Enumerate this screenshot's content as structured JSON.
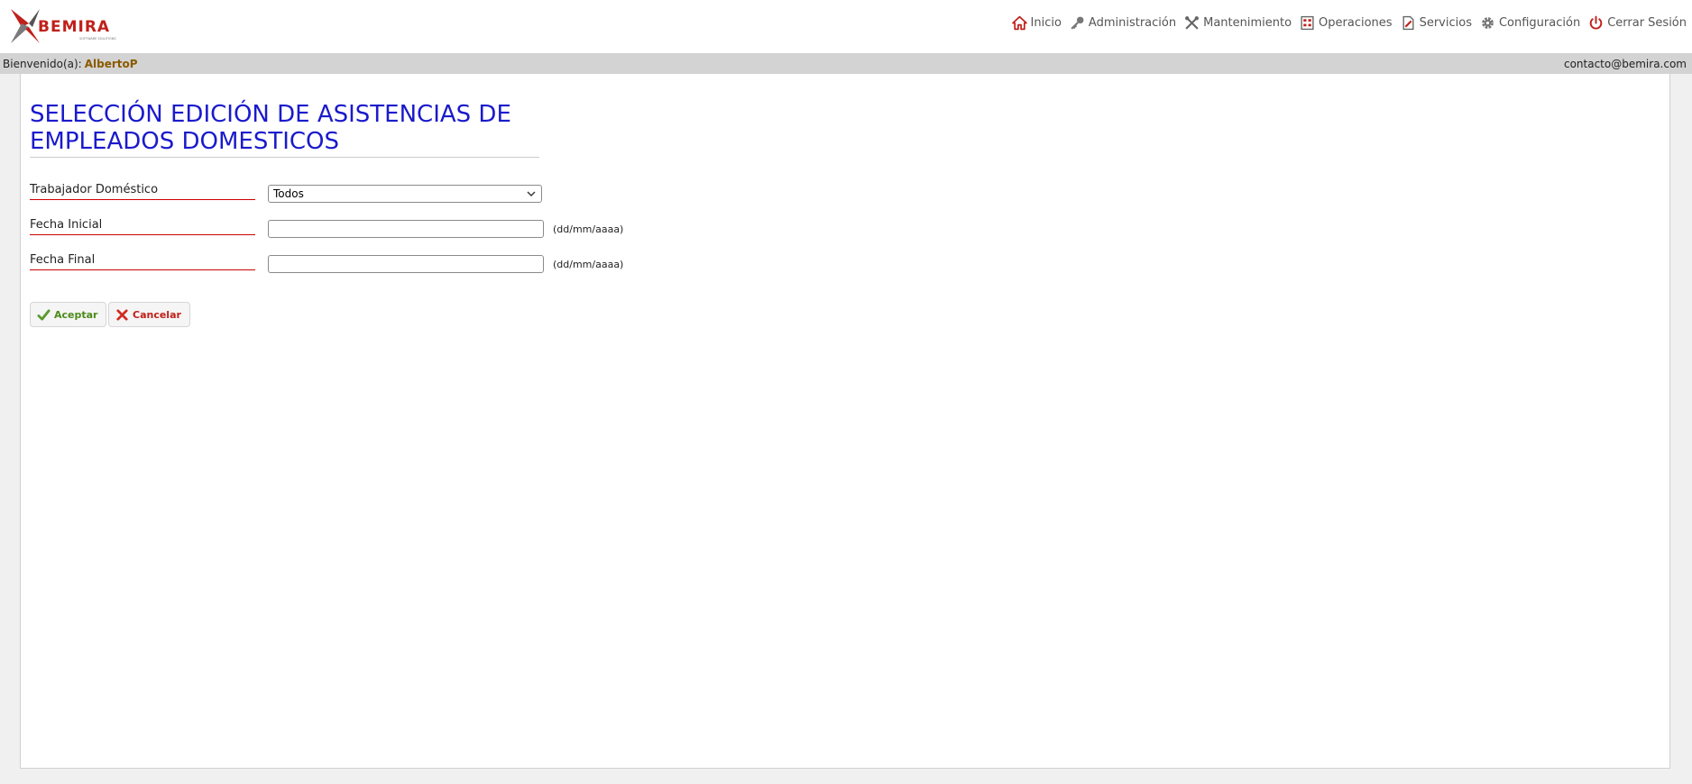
{
  "header": {
    "logo_text": "BEMIRA",
    "logo_tagline": "SOFTWARE SOLUTIONS",
    "nav": [
      {
        "label": "Inicio",
        "icon": "home-icon"
      },
      {
        "label": "Administración",
        "icon": "key-icon"
      },
      {
        "label": "Mantenimiento",
        "icon": "tools-icon"
      },
      {
        "label": "Operaciones",
        "icon": "calculator-icon"
      },
      {
        "label": "Servicios",
        "icon": "document-edit-icon"
      },
      {
        "label": "Configuración",
        "icon": "gear-icon"
      },
      {
        "label": "Cerrar Sesión",
        "icon": "power-icon"
      }
    ]
  },
  "welcome": {
    "prefix": "Bienvenido(a):",
    "user": "AlbertoP",
    "contact": "contacto@bemira.com"
  },
  "page": {
    "title": "SELECCIÓN EDICIÓN DE ASISTENCIAS DE EMPLEADOS DOMESTICOS"
  },
  "form": {
    "worker_label": "Trabajador Doméstico",
    "worker_value": "Todos",
    "start_label": "Fecha Inicial",
    "start_value": "",
    "start_hint": "(dd/mm/aaaa)",
    "end_label": "Fecha Final",
    "end_value": "",
    "end_hint": "(dd/mm/aaaa)"
  },
  "buttons": {
    "accept": "Aceptar",
    "cancel": "Cancelar"
  },
  "colors": {
    "title": "#1a1acc",
    "label_underline": "#cc0000",
    "accept_text": "#4c8a1a",
    "cancel_text": "#c0201a",
    "welcome_user": "#8a5a00"
  }
}
